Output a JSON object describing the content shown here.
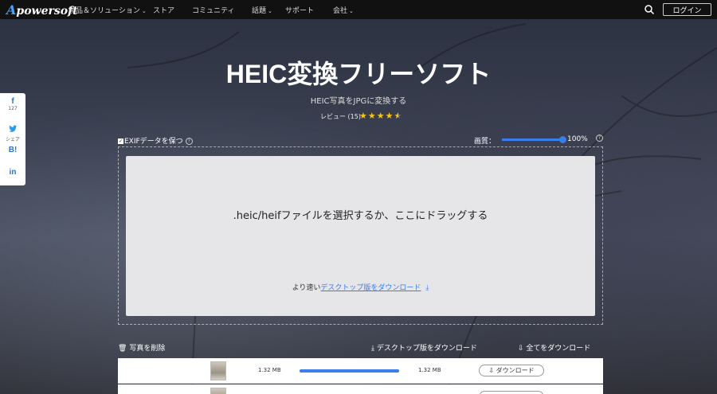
{
  "nav": {
    "logo_first": "A",
    "logo_rest": "powersoft",
    "items": [
      {
        "label": "製品＆ソリューション",
        "has_caret": true
      },
      {
        "label": "ストア",
        "has_caret": false
      },
      {
        "label": "コミュニティ",
        "has_caret": false
      },
      {
        "label": "話題",
        "has_caret": true
      },
      {
        "label": "サポート",
        "has_caret": false
      },
      {
        "label": "会社",
        "has_caret": true
      }
    ],
    "login_label": "ログイン",
    "search_icon": "search-icon"
  },
  "share": {
    "facebook": {
      "icon": "f",
      "count": "127"
    },
    "twitter": {
      "icon": "twitter-icon",
      "label": "シェア"
    },
    "hatena": {
      "icon": "B!"
    },
    "linkedin": {
      "icon": "in"
    }
  },
  "hero": {
    "title": "HEIC変換フリーソフト",
    "subtitle": "HEIC写真をJPGに変換する",
    "review_label": "レビュー (15)",
    "rating": 4.5
  },
  "options": {
    "exif_label": "EXIFデータを保つ",
    "exif_checked": true,
    "quality_label": "画質：",
    "quality_value": "100%",
    "quality_fraction": 1.0
  },
  "dropzone": {
    "main_text": ".heic/heifファイルを選択するか、ここにドラッグする",
    "sub_prefix": "より速い",
    "sub_link": "デスクトップ版をダウンロード",
    "download_icon": "download-icon"
  },
  "list": {
    "delete_all_label": "写真を削除",
    "desktop_download_label": "デスクトップ版をダウンロード",
    "download_all_label": "全てをダウンロード"
  },
  "files": [
    {
      "size_before": "1.32 MB",
      "size_after": "1.32 MB",
      "progress": 1.0,
      "button_label": "ダウンロード"
    },
    {
      "size_before": "",
      "size_after": "",
      "progress": 1.0,
      "button_label": ""
    }
  ],
  "colors": {
    "accent": "#3b7de9",
    "star": "#f5c518",
    "nav_bg": "#111111"
  }
}
